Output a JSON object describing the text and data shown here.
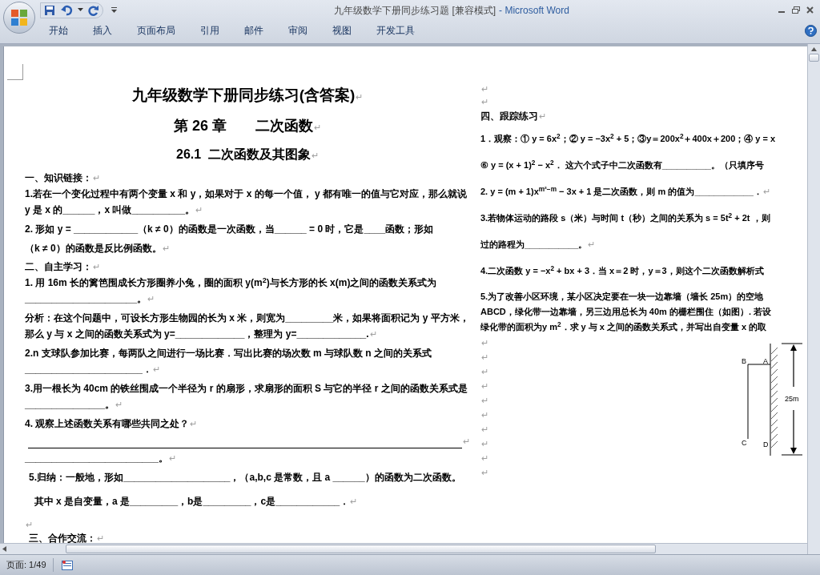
{
  "title_bar": {
    "document": "九年级数学下册同步练习题 [兼容模式]",
    "app": "- Microsoft Word"
  },
  "ribbon_tabs": [
    {
      "label": "开始"
    },
    {
      "label": "插入"
    },
    {
      "label": "页面布局"
    },
    {
      "label": "引用"
    },
    {
      "label": "邮件"
    },
    {
      "label": "审阅"
    },
    {
      "label": "视图"
    },
    {
      "label": "开发工具"
    }
  ],
  "left_column": [
    {
      "kind": "title",
      "text": "九年级数学下册同步练习(含答案)",
      "end_mark": "↵"
    },
    {
      "kind": "chapter",
      "text": "第 26 章　　二次函数",
      "end_mark": "↵"
    },
    {
      "kind": "subtitle",
      "text": "26.1  二次函数及其图象",
      "end_mark": "↵"
    },
    {
      "kind": "section",
      "text": "一、知识链接：",
      "end_mark": "↵"
    },
    {
      "kind": "text",
      "text": "1.若在一个变化过程中有两个变量 x 和 y，如果对于 x 的每一个值， y 都有唯一的值与它对应，那么就说 y 是 x 的______，x 叫做__________。",
      "end_mark": "↵"
    },
    {
      "kind": "text",
      "text": "2.  形如 y = ____________（k ≠ 0）的函数是一次函数，当______ = 0 时，它是____函数；形如"
    },
    {
      "kind": "text",
      "text": "（k ≠ 0）的函数是反比例函数。",
      "end_mark": "↵"
    },
    {
      "kind": "section",
      "text": "二、自主学习：",
      "end_mark": "↵"
    },
    {
      "kind": "text",
      "text": "1. 用  16m  长的篱笆围成长方形圈养小兔，圈的面积  y(m$^{2}$)与长方形的长  x(m)之间的函数关系式为_____________________。",
      "end_mark": "↵"
    },
    {
      "kind": "text",
      "text": "分析：在这个问题中，可设长方形生物园的长为 x 米，则宽为_________米，如果将面积记为 y 平方米，那么 y 与 x 之间的函数关系式为 y=_____________，整理为 y=_____________.",
      "end_mark": "↵"
    },
    {
      "kind": "text",
      "text": "2.n 支球队参加比赛，每两队之间进行一场比赛．写出比赛的场次数 m 与球队数 n 之间的关系式______________________．",
      "end_mark": "↵"
    },
    {
      "kind": "text",
      "text": "3.用一根长为 40cm 的铁丝围成一个半径为 r 的扇形，求扇形的面积 S 与它的半径 r 之间的函数关系式是_______________。",
      "end_mark": "↵"
    },
    {
      "kind": "text",
      "text": "4. 观察上述函数关系有哪些共同之处？",
      "end_mark": "↵"
    },
    {
      "kind": "rule",
      "end_mark": "↵"
    },
    {
      "kind": "text",
      "text": "_________________________。",
      "end_mark": "↵"
    },
    {
      "kind": "indented",
      "text": "5.归纳：一般地，形如____________________，（a,b,c 是常数，且 a ______）的函数为二次函数。"
    },
    {
      "kind": "indented",
      "text": "  其中 x 是自变量，a 是_________，b是_________，c是____________．",
      "end_mark": "↵"
    },
    {
      "kind": "blank",
      "end_mark": "↵"
    },
    {
      "kind": "indented",
      "text": "三、合作交流：",
      "end_mark": "↵"
    }
  ],
  "right_column": [
    {
      "kind": "blank",
      "end_mark": "↵"
    },
    {
      "kind": "blank",
      "end_mark": "↵"
    },
    {
      "kind": "section",
      "text": "四、跟踪练习",
      "end_mark": "↵"
    },
    {
      "kind": "line",
      "text": "1．观察：① y = 6x$^{2}$；② y = −3x$^{2}$ + 5；③y＝200x$^{2}$＋400x＋200；④ y = x"
    },
    {
      "kind": "line",
      "text": "⑥ y = (x + 1)$^{2}$ − x$^{2}$． 这六个式子中二次函数有__________。（只填序号"
    },
    {
      "kind": "line",
      "text": "2. y = (m + 1)x$^{m²−m}$ − 3x + 1  是二次函数，则 m 的值为____________．",
      "end_mark": "↵"
    },
    {
      "kind": "line",
      "text": "3.若物体运动的路段 s（米）与时间 t（秒）之间的关系为 s = 5t$^{2}$ + 2t ，则"
    },
    {
      "kind": "line",
      "text": "过的路程为___________。",
      "end_mark": "↵"
    },
    {
      "kind": "line",
      "text": "4.二次函数 y = −x$^{2}$ + bx + 3．当 x＝2 时，y＝3，则这个二次函数解析式"
    },
    {
      "kind": "tight",
      "text": "5.为了改善小区环境，某小区决定要在一块一边靠墙（墙长 25m）的空地"
    },
    {
      "kind": "tight",
      "text": "ABCD，绿化带一边靠墙，另三边用总长为 40m 的栅栏围住（如图）. 若设"
    },
    {
      "kind": "tight",
      "text": "绿化带的面积为y m$^{2}$．求 y 与 x 之间的函数关系式，并写出自变量 x 的取"
    }
  ],
  "blank_marks": [
    "↵",
    "↵",
    "↵",
    "↵",
    "↵",
    "↵",
    "↵",
    "↵",
    "↵",
    "↵"
  ],
  "figure": {
    "labels": [
      "B",
      "A",
      "C",
      "D"
    ],
    "length": "25m"
  },
  "status_bar": {
    "page": "页面: 1/49"
  }
}
